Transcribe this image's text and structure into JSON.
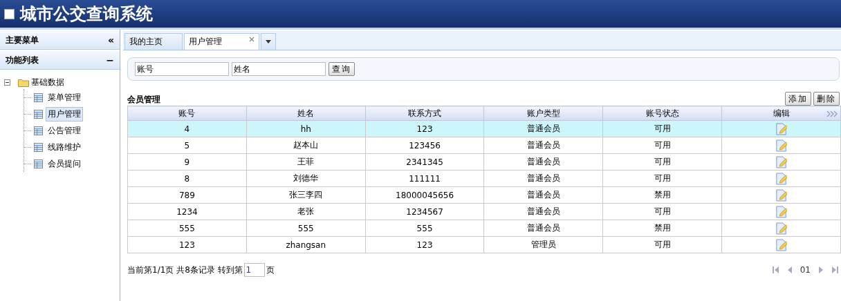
{
  "header": {
    "title": "城市公交查询系统"
  },
  "sidebar": {
    "title": "主要菜单",
    "collapse": "«",
    "section": {
      "title": "功能列表",
      "toggle": "−"
    },
    "tree": [
      {
        "label": "基础数据",
        "expanded": true,
        "children": [
          {
            "label": "菜单管理",
            "selected": false
          },
          {
            "label": "用户管理",
            "selected": true
          },
          {
            "label": "公告管理",
            "selected": false
          },
          {
            "label": "线路维护",
            "selected": false
          },
          {
            "label": "会员提问",
            "selected": false
          }
        ]
      }
    ]
  },
  "tabs": [
    {
      "label": "我的主页",
      "selected": false,
      "closable": false
    },
    {
      "label": "用户管理",
      "selected": true,
      "closable": true
    }
  ],
  "search": {
    "fields": [
      {
        "placeholder": "账号"
      },
      {
        "placeholder": "姓名"
      }
    ],
    "button": "查询"
  },
  "section_title": "会员管理",
  "actions": [
    "添加",
    "删除"
  ],
  "table": {
    "columns": [
      "账号",
      "姓名",
      "联系方式",
      "账户类型",
      "账号状态",
      "编辑"
    ],
    "rows": [
      {
        "selected": true,
        "cells": [
          "4",
          "hh",
          "123",
          "普通会员",
          "可用"
        ]
      },
      {
        "selected": false,
        "cells": [
          "5",
          "赵本山",
          "123456",
          "普通会员",
          "可用"
        ]
      },
      {
        "selected": false,
        "cells": [
          "9",
          "王菲",
          "2341345",
          "普通会员",
          "可用"
        ]
      },
      {
        "selected": false,
        "cells": [
          "8",
          "刘德华",
          "111111",
          "普通会员",
          "可用"
        ]
      },
      {
        "selected": false,
        "cells": [
          "789",
          "张三李四",
          "18000045656",
          "普通会员",
          "禁用"
        ]
      },
      {
        "selected": false,
        "cells": [
          "1234",
          "老张",
          "1234567",
          "普通会员",
          "可用"
        ]
      },
      {
        "selected": false,
        "cells": [
          "555",
          "555",
          "555",
          "普通会员",
          "禁用"
        ]
      },
      {
        "selected": false,
        "cells": [
          "123",
          "zhangsan",
          "123",
          "管理员",
          "可用"
        ]
      }
    ]
  },
  "pager": {
    "summary": "当前第1/1页 共8条记录 转到第",
    "page_input": "1",
    "page_suffix": "页",
    "current": "01"
  }
}
